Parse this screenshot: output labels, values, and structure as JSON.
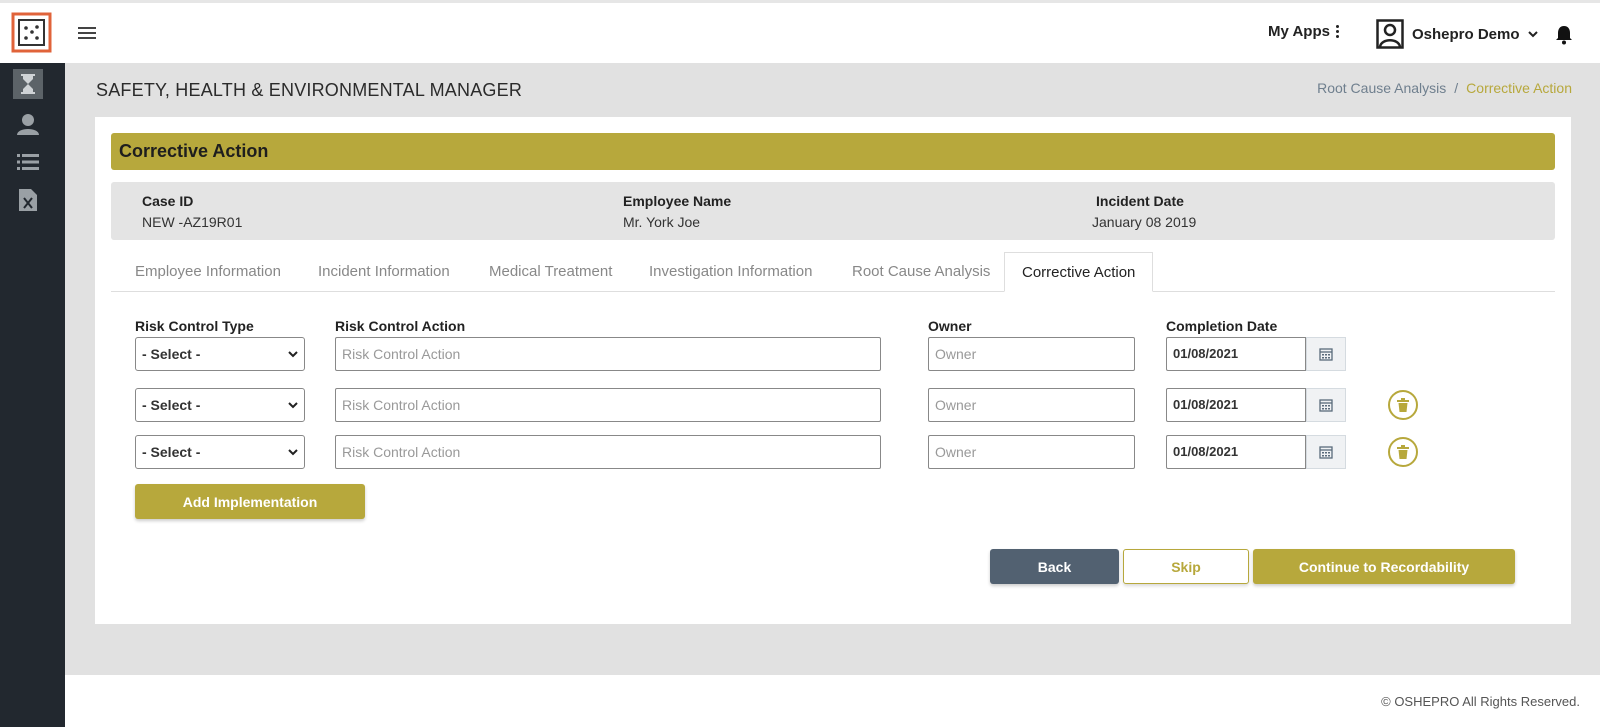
{
  "app": {
    "title": "SAFETY, HEALTH & ENVIRONMENTAL MANAGER"
  },
  "topbar": {
    "my_apps_label": "My Apps",
    "user_name": "Oshepro Demo"
  },
  "sidebar": {
    "items": [
      {
        "name": "hourglass-icon",
        "active": true
      },
      {
        "name": "user-icon",
        "active": false
      },
      {
        "name": "list-icon",
        "active": false
      },
      {
        "name": "excel-file-icon",
        "active": false
      }
    ]
  },
  "breadcrumb": {
    "items": [
      "Root Cause Analysis",
      "Corrective Action"
    ],
    "separator": "/"
  },
  "section": {
    "title": "Corrective Action"
  },
  "summary": {
    "case_id_label": "Case ID",
    "case_id_value": "NEW -AZ19R01",
    "employee_name_label": "Employee Name",
    "employee_name_value": "Mr. York Joe",
    "incident_date_label": "Incident Date",
    "incident_date_value": "January 08 2019"
  },
  "tabs": [
    {
      "label": "Employee Information",
      "active": false
    },
    {
      "label": "Incident Information",
      "active": false
    },
    {
      "label": "Medical Treatment",
      "active": false
    },
    {
      "label": "Investigation Information",
      "active": false
    },
    {
      "label": "Root Cause Analysis",
      "active": false
    },
    {
      "label": "Corrective Action",
      "active": true
    }
  ],
  "form": {
    "columns": {
      "risk_control_type": "Risk Control Type",
      "risk_control_action": "Risk Control Action",
      "owner": "Owner",
      "completion_date": "Completion Date"
    },
    "rows": [
      {
        "type_value": "- Select -",
        "action_placeholder": "Risk Control Action",
        "owner_placeholder": "Owner",
        "date_value": "01/08/2021",
        "deletable": false
      },
      {
        "type_value": "- Select -",
        "action_placeholder": "Risk Control Action",
        "owner_placeholder": "Owner",
        "date_value": "01/08/2021",
        "deletable": true
      },
      {
        "type_value": "- Select -",
        "action_placeholder": "Risk Control Action",
        "owner_placeholder": "Owner",
        "date_value": "01/08/2021",
        "deletable": true
      }
    ],
    "add_label": "Add Implementation"
  },
  "actions": {
    "back_label": "Back",
    "skip_label": "Skip",
    "continue_label": "Continue to Recordability"
  },
  "footer": {
    "copyright": "© OSHEPRO All Rights Reserved."
  },
  "colors": {
    "accent": "#b7a83c",
    "sidebar": "#22282f",
    "back_button": "#526171"
  }
}
